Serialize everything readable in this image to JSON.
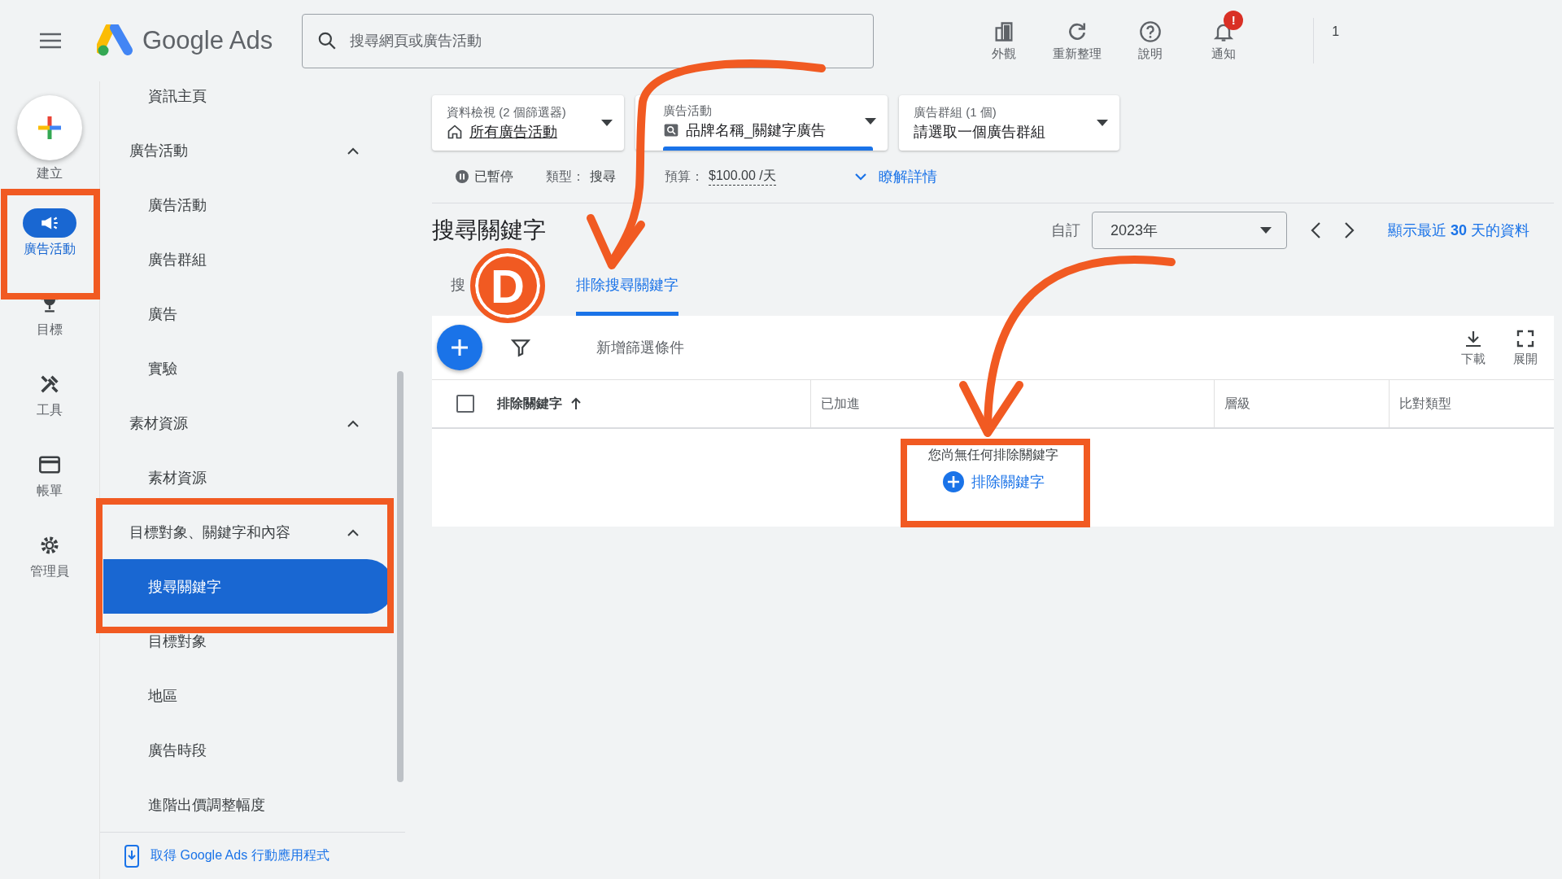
{
  "header": {
    "product_name": "Google Ads",
    "search": {
      "placeholder": "搜尋網頁或廣告活動"
    },
    "actions": [
      {
        "kind": "appearance",
        "label": "外觀"
      },
      {
        "kind": "refresh",
        "label": "重新整理"
      },
      {
        "kind": "help",
        "label": "說明"
      },
      {
        "kind": "notifications",
        "label": "通知",
        "badge": "!"
      }
    ],
    "account": "1"
  },
  "rail": {
    "create": "建立",
    "items": [
      {
        "kind": "campaigns",
        "label": "廣告活動",
        "selected": true
      },
      {
        "kind": "goals",
        "label": "目標",
        "selected": false
      },
      {
        "kind": "tools",
        "label": "工具",
        "selected": false
      },
      {
        "kind": "billing",
        "label": "帳單",
        "selected": false
      },
      {
        "kind": "admin",
        "label": "管理員",
        "selected": false
      }
    ]
  },
  "nav": {
    "items": [
      {
        "label": "資訊主頁",
        "selected": false
      },
      {
        "label": "廣告活動",
        "expanded": true,
        "children": [
          {
            "label": "廣告活動",
            "selected": false
          },
          {
            "label": "廣告群組",
            "selected": false
          },
          {
            "label": "廣告",
            "selected": false
          },
          {
            "label": "實驗",
            "selected": false
          }
        ]
      },
      {
        "label": "素材資源",
        "expanded": true,
        "children": [
          {
            "label": "素材資源",
            "selected": false
          }
        ]
      },
      {
        "label": "目標對象、關鍵字和內容",
        "expanded": true,
        "children": [
          {
            "label": "搜尋關鍵字",
            "selected": true
          },
          {
            "label": "目標對象",
            "selected": false
          },
          {
            "label": "地區",
            "selected": false
          },
          {
            "label": "廣告時段",
            "selected": false
          },
          {
            "label": "進階出價調整幅度",
            "selected": false
          }
        ]
      }
    ],
    "footer_link": "取得 Google Ads 行動應用程式"
  },
  "filters": [
    {
      "kind": "view",
      "label": "資料檢視 (2 個篩選器)",
      "value": "所有廣告活動",
      "selected": false
    },
    {
      "kind": "campaign",
      "label": "廣告活動",
      "value": "品牌名稱_關鍵字廣告",
      "selected": true
    },
    {
      "kind": "ad_group",
      "label": "廣告群組 (1 個)",
      "value": "請選取一個廣告群組",
      "selected": false
    }
  ],
  "summary": {
    "status": "已暫停",
    "type_label": "類型：",
    "type_value": "搜尋",
    "budget_label": "預算：",
    "budget_value": "$100.00 /天",
    "details_link": "瞭解詳情"
  },
  "page": {
    "title": "搜尋關鍵字",
    "date_label": "自訂",
    "date_value": "2023年",
    "recent_link": "顯示最近 **30** 天的資料"
  },
  "tabs": [
    {
      "label": "搜",
      "selected": false
    },
    {
      "label": "排除搜尋關鍵字",
      "selected": true
    }
  ],
  "toolbar": {
    "add_filter": "新增篩選條件",
    "actions": [
      {
        "kind": "download",
        "label": "下載"
      },
      {
        "kind": "expand",
        "label": "展開"
      }
    ]
  },
  "table": {
    "select_all": {
      "checked": false
    },
    "columns": [
      {
        "label": "排除關鍵字",
        "sorted": true
      },
      {
        "label": "已加進",
        "sorted": false
      },
      {
        "label": "層級",
        "sorted": false
      },
      {
        "label": "比對類型",
        "sorted": false
      }
    ],
    "empty": {
      "message": "您尚無任何排除關鍵字",
      "action": "排除關鍵字"
    }
  },
  "annotation": {
    "badge": "D"
  }
}
